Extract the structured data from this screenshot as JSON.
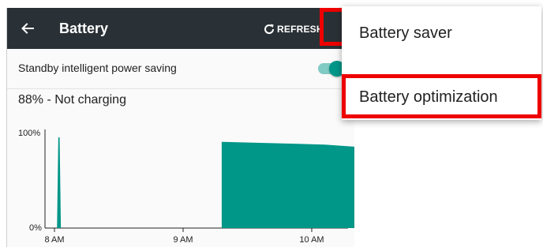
{
  "appbar": {
    "title": "Battery",
    "back_icon": "arrow-back-icon",
    "refresh_label": "REFRESH",
    "refresh_icon": "refresh-icon",
    "overflow_icon": "more-vert-icon",
    "background": "#2a3136"
  },
  "settings": {
    "standby_label": "Standby intelligent power saving",
    "standby_enabled": true
  },
  "status": {
    "text": "88% - Not charging"
  },
  "chart_data": {
    "type": "area",
    "ylabels": [
      "100%",
      "0%"
    ],
    "xlabels": [
      "8 AM",
      "9 AM",
      "10 AM"
    ],
    "ylim": [
      0,
      100
    ],
    "color": "#009688",
    "series": [
      {
        "values": [
          [
            0.02,
            0
          ],
          [
            0.03,
            100
          ],
          [
            0.04,
            100
          ],
          [
            0.05,
            0
          ]
        ]
      },
      {
        "values": [
          [
            1.3,
            0
          ],
          [
            1.3,
            95
          ],
          [
            2.1,
            92
          ],
          [
            2.5,
            88
          ],
          [
            2.5,
            0
          ]
        ]
      }
    ]
  },
  "menu": {
    "items": [
      {
        "label": "Battery saver",
        "highlighted": false
      },
      {
        "label": "Battery optimization",
        "highlighted": true
      }
    ],
    "highlight_color": "#ee0000"
  }
}
